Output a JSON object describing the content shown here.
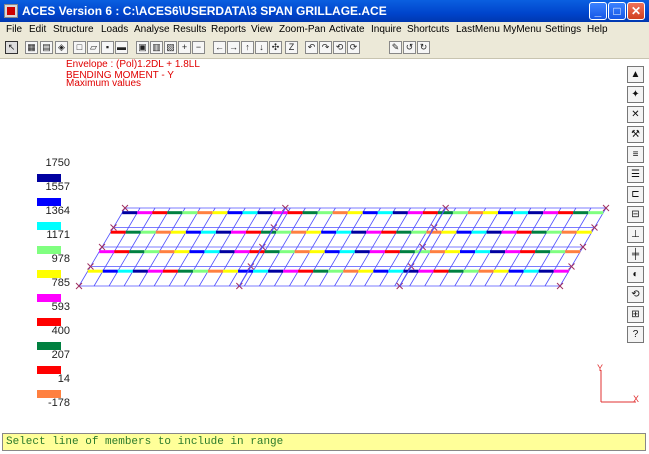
{
  "window": {
    "title": "ACES Version 6 : C:\\ACES6\\USERDATA\\3 SPAN GRILLAGE.ACE"
  },
  "menu": {
    "items": [
      "File",
      "Edit",
      "Structure",
      "Loads",
      "Analyse",
      "Results",
      "Reports",
      "View",
      "Zoom-Pan",
      "Activate",
      "Inquire",
      "Shortcuts",
      "LastMenu",
      "MyMenu",
      "Settings",
      "Help"
    ]
  },
  "envelope": {
    "line1": "Envelope : (Pol)1.2DL + 1.8LL",
    "line2": "BENDING MOMENT - Y",
    "line3": "Maximum values"
  },
  "legend": {
    "values": [
      "1750",
      "1557",
      "1364",
      "1171",
      "978",
      "785",
      "593",
      "400",
      "207",
      "14",
      "-178"
    ],
    "colors": [
      "#0000a0",
      "#0000ff",
      "#00ffff",
      "#80ff80",
      "#ffff00",
      "#ff00ff",
      "#ff0000",
      "#008040",
      "#ff0000",
      "#ff8040"
    ]
  },
  "axis": {
    "y_label": "Y",
    "x_label": "X"
  },
  "status": {
    "text": "Select line of members to include in range"
  }
}
